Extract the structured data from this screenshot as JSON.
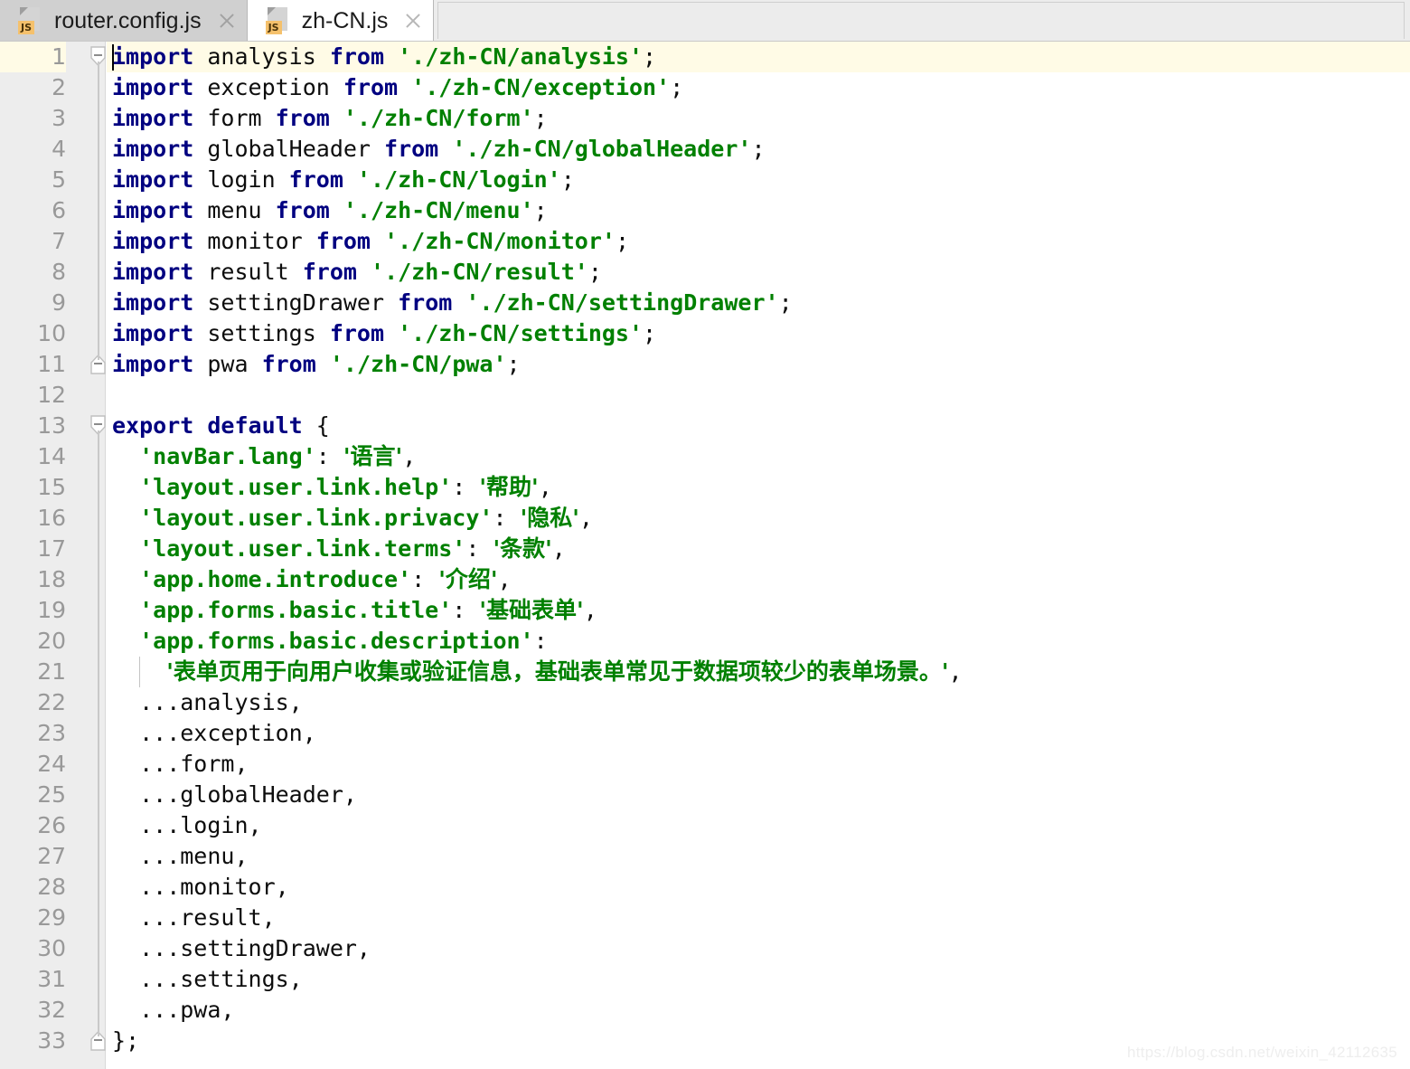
{
  "window": {
    "app": "code-editor",
    "watermark": "https://blog.csdn.net/weixin_42112635"
  },
  "tabbar": {
    "tabs": [
      {
        "label": "router.config.js",
        "icon": "js-file-icon",
        "badge": "JS",
        "active": false,
        "close_icon": "close-icon"
      },
      {
        "label": "zh-CN.js",
        "icon": "js-file-icon",
        "badge": "JS",
        "active": true,
        "close_icon": "close-icon"
      }
    ]
  },
  "editor": {
    "language": "javascript",
    "current_line": 1,
    "colors": {
      "keyword": "#000080",
      "string": "#008000",
      "plain": "#0d0d0d",
      "gutter_bg": "#ededed",
      "line_number": "#999999",
      "current_line_bg": "#fffbe6",
      "editor_bg": "#ffffff"
    },
    "lines": [
      {
        "n": "1",
        "fold": "start",
        "tokens": [
          {
            "t": "kw",
            "v": "import"
          },
          {
            "t": "pl",
            "v": " analysis "
          },
          {
            "t": "kw",
            "v": "from"
          },
          {
            "t": "pl",
            "v": " "
          },
          {
            "t": "str",
            "v": "'./zh-CN/analysis'"
          },
          {
            "t": "pl",
            "v": ";"
          }
        ]
      },
      {
        "n": "2",
        "fold": "none",
        "tokens": [
          {
            "t": "kw",
            "v": "import"
          },
          {
            "t": "pl",
            "v": " exception "
          },
          {
            "t": "kw",
            "v": "from"
          },
          {
            "t": "pl",
            "v": " "
          },
          {
            "t": "str",
            "v": "'./zh-CN/exception'"
          },
          {
            "t": "pl",
            "v": ";"
          }
        ]
      },
      {
        "n": "3",
        "fold": "none",
        "tokens": [
          {
            "t": "kw",
            "v": "import"
          },
          {
            "t": "pl",
            "v": " form "
          },
          {
            "t": "kw",
            "v": "from"
          },
          {
            "t": "pl",
            "v": " "
          },
          {
            "t": "str",
            "v": "'./zh-CN/form'"
          },
          {
            "t": "pl",
            "v": ";"
          }
        ]
      },
      {
        "n": "4",
        "fold": "none",
        "tokens": [
          {
            "t": "kw",
            "v": "import"
          },
          {
            "t": "pl",
            "v": " globalHeader "
          },
          {
            "t": "kw",
            "v": "from"
          },
          {
            "t": "pl",
            "v": " "
          },
          {
            "t": "str",
            "v": "'./zh-CN/globalHeader'"
          },
          {
            "t": "pl",
            "v": ";"
          }
        ]
      },
      {
        "n": "5",
        "fold": "none",
        "tokens": [
          {
            "t": "kw",
            "v": "import"
          },
          {
            "t": "pl",
            "v": " login "
          },
          {
            "t": "kw",
            "v": "from"
          },
          {
            "t": "pl",
            "v": " "
          },
          {
            "t": "str",
            "v": "'./zh-CN/login'"
          },
          {
            "t": "pl",
            "v": ";"
          }
        ]
      },
      {
        "n": "6",
        "fold": "none",
        "tokens": [
          {
            "t": "kw",
            "v": "import"
          },
          {
            "t": "pl",
            "v": " menu "
          },
          {
            "t": "kw",
            "v": "from"
          },
          {
            "t": "pl",
            "v": " "
          },
          {
            "t": "str",
            "v": "'./zh-CN/menu'"
          },
          {
            "t": "pl",
            "v": ";"
          }
        ]
      },
      {
        "n": "7",
        "fold": "none",
        "tokens": [
          {
            "t": "kw",
            "v": "import"
          },
          {
            "t": "pl",
            "v": " monitor "
          },
          {
            "t": "kw",
            "v": "from"
          },
          {
            "t": "pl",
            "v": " "
          },
          {
            "t": "str",
            "v": "'./zh-CN/monitor'"
          },
          {
            "t": "pl",
            "v": ";"
          }
        ]
      },
      {
        "n": "8",
        "fold": "none",
        "tokens": [
          {
            "t": "kw",
            "v": "import"
          },
          {
            "t": "pl",
            "v": " result "
          },
          {
            "t": "kw",
            "v": "from"
          },
          {
            "t": "pl",
            "v": " "
          },
          {
            "t": "str",
            "v": "'./zh-CN/result'"
          },
          {
            "t": "pl",
            "v": ";"
          }
        ]
      },
      {
        "n": "9",
        "fold": "none",
        "tokens": [
          {
            "t": "kw",
            "v": "import"
          },
          {
            "t": "pl",
            "v": " settingDrawer "
          },
          {
            "t": "kw",
            "v": "from"
          },
          {
            "t": "pl",
            "v": " "
          },
          {
            "t": "str",
            "v": "'./zh-CN/settingDrawer'"
          },
          {
            "t": "pl",
            "v": ";"
          }
        ]
      },
      {
        "n": "10",
        "fold": "none",
        "tokens": [
          {
            "t": "kw",
            "v": "import"
          },
          {
            "t": "pl",
            "v": " settings "
          },
          {
            "t": "kw",
            "v": "from"
          },
          {
            "t": "pl",
            "v": " "
          },
          {
            "t": "str",
            "v": "'./zh-CN/settings'"
          },
          {
            "t": "pl",
            "v": ";"
          }
        ]
      },
      {
        "n": "11",
        "fold": "end",
        "tokens": [
          {
            "t": "kw",
            "v": "import"
          },
          {
            "t": "pl",
            "v": " pwa "
          },
          {
            "t": "kw",
            "v": "from"
          },
          {
            "t": "pl",
            "v": " "
          },
          {
            "t": "str",
            "v": "'./zh-CN/pwa'"
          },
          {
            "t": "pl",
            "v": ";"
          }
        ]
      },
      {
        "n": "12",
        "fold": "none",
        "tokens": []
      },
      {
        "n": "13",
        "fold": "start",
        "tokens": [
          {
            "t": "kw",
            "v": "export default"
          },
          {
            "t": "pl",
            "v": " {"
          }
        ]
      },
      {
        "n": "14",
        "fold": "none",
        "tokens": [
          {
            "t": "pl",
            "v": "  "
          },
          {
            "t": "str",
            "v": "'navBar.lang'"
          },
          {
            "t": "pl",
            "v": ": "
          },
          {
            "t": "cjk",
            "v": "'语言'"
          },
          {
            "t": "pl",
            "v": ","
          }
        ]
      },
      {
        "n": "15",
        "fold": "none",
        "tokens": [
          {
            "t": "pl",
            "v": "  "
          },
          {
            "t": "str",
            "v": "'layout.user.link.help'"
          },
          {
            "t": "pl",
            "v": ": "
          },
          {
            "t": "cjk",
            "v": "'帮助'"
          },
          {
            "t": "pl",
            "v": ","
          }
        ]
      },
      {
        "n": "16",
        "fold": "none",
        "tokens": [
          {
            "t": "pl",
            "v": "  "
          },
          {
            "t": "str",
            "v": "'layout.user.link.privacy'"
          },
          {
            "t": "pl",
            "v": ": "
          },
          {
            "t": "cjk",
            "v": "'隐私'"
          },
          {
            "t": "pl",
            "v": ","
          }
        ]
      },
      {
        "n": "17",
        "fold": "none",
        "tokens": [
          {
            "t": "pl",
            "v": "  "
          },
          {
            "t": "str",
            "v": "'layout.user.link.terms'"
          },
          {
            "t": "pl",
            "v": ": "
          },
          {
            "t": "cjk",
            "v": "'条款'"
          },
          {
            "t": "pl",
            "v": ","
          }
        ]
      },
      {
        "n": "18",
        "fold": "none",
        "tokens": [
          {
            "t": "pl",
            "v": "  "
          },
          {
            "t": "str",
            "v": "'app.home.introduce'"
          },
          {
            "t": "pl",
            "v": ": "
          },
          {
            "t": "cjk",
            "v": "'介绍'"
          },
          {
            "t": "pl",
            "v": ","
          }
        ]
      },
      {
        "n": "19",
        "fold": "none",
        "tokens": [
          {
            "t": "pl",
            "v": "  "
          },
          {
            "t": "str",
            "v": "'app.forms.basic.title'"
          },
          {
            "t": "pl",
            "v": ": "
          },
          {
            "t": "cjk",
            "v": "'基础表单'"
          },
          {
            "t": "pl",
            "v": ","
          }
        ]
      },
      {
        "n": "20",
        "fold": "none",
        "tokens": [
          {
            "t": "pl",
            "v": "  "
          },
          {
            "t": "str",
            "v": "'app.forms.basic.description'"
          },
          {
            "t": "pl",
            "v": ":"
          }
        ]
      },
      {
        "n": "21",
        "fold": "none",
        "indent_guide": true,
        "tokens": [
          {
            "t": "pl",
            "v": "    "
          },
          {
            "t": "cjk",
            "v": "'表单页用于向用户收集或验证信息，基础表单常见于数据项较少的表单场景。'"
          },
          {
            "t": "pl",
            "v": ","
          }
        ]
      },
      {
        "n": "22",
        "fold": "none",
        "tokens": [
          {
            "t": "pl",
            "v": "  ...analysis,"
          }
        ]
      },
      {
        "n": "23",
        "fold": "none",
        "tokens": [
          {
            "t": "pl",
            "v": "  ...exception,"
          }
        ]
      },
      {
        "n": "24",
        "fold": "none",
        "tokens": [
          {
            "t": "pl",
            "v": "  ...form,"
          }
        ]
      },
      {
        "n": "25",
        "fold": "none",
        "tokens": [
          {
            "t": "pl",
            "v": "  ...globalHeader,"
          }
        ]
      },
      {
        "n": "26",
        "fold": "none",
        "tokens": [
          {
            "t": "pl",
            "v": "  ...login,"
          }
        ]
      },
      {
        "n": "27",
        "fold": "none",
        "tokens": [
          {
            "t": "pl",
            "v": "  ...menu,"
          }
        ]
      },
      {
        "n": "28",
        "fold": "none",
        "tokens": [
          {
            "t": "pl",
            "v": "  ...monitor,"
          }
        ]
      },
      {
        "n": "29",
        "fold": "none",
        "tokens": [
          {
            "t": "pl",
            "v": "  ...result,"
          }
        ]
      },
      {
        "n": "30",
        "fold": "none",
        "tokens": [
          {
            "t": "pl",
            "v": "  ...settingDrawer,"
          }
        ]
      },
      {
        "n": "31",
        "fold": "none",
        "tokens": [
          {
            "t": "pl",
            "v": "  ...settings,"
          }
        ]
      },
      {
        "n": "32",
        "fold": "none",
        "tokens": [
          {
            "t": "pl",
            "v": "  ...pwa,"
          }
        ]
      },
      {
        "n": "33",
        "fold": "end",
        "tokens": [
          {
            "t": "pl",
            "v": "};"
          }
        ]
      }
    ]
  }
}
